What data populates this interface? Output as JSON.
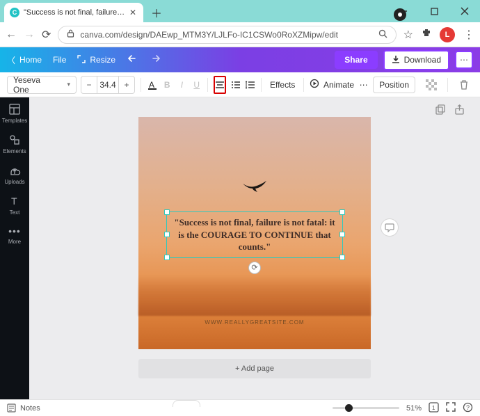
{
  "browser": {
    "tab_title": "\"Success is not final, failure is no",
    "url": "canva.com/design/DAEwp_MTM3Y/LJLFo-IC1CSWo0RoXZMipw/edit",
    "user_initial": "L"
  },
  "header": {
    "home": "Home",
    "file": "File",
    "resize": "Resize",
    "share": "Share",
    "download": "Download"
  },
  "toolbar": {
    "font_name": "Yeseva One",
    "font_size": "34.4",
    "effects": "Effects",
    "animate": "Animate",
    "position": "Position"
  },
  "sidebar": {
    "items": [
      {
        "label": "Templates"
      },
      {
        "label": "Elements"
      },
      {
        "label": "Uploads"
      },
      {
        "label": "Text"
      },
      {
        "label": "More"
      }
    ]
  },
  "design": {
    "quote": "\"Success is not final, failure is not fatal: it is the COURAGE TO CONTINUE that counts.\"",
    "website": "WWW.REALLYGREATSITE.COM",
    "add_page": "+ Add page"
  },
  "bottom": {
    "notes": "Notes",
    "zoom": "51%"
  }
}
